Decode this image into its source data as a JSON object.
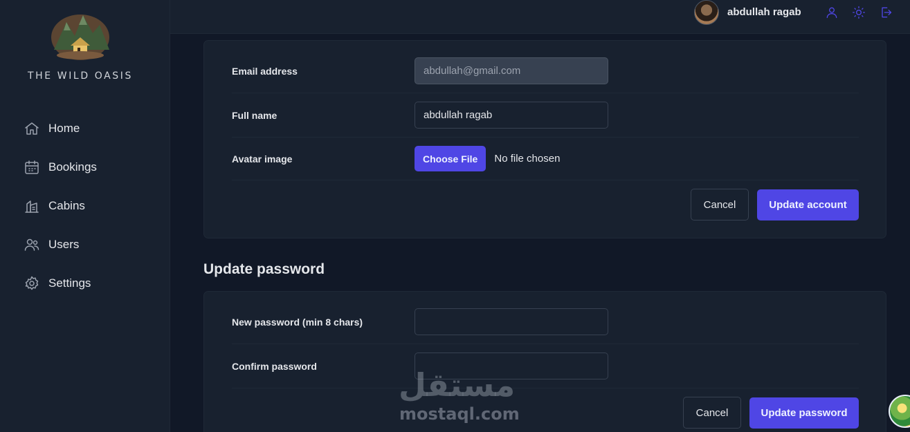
{
  "brand": {
    "name": "THE WILD OASIS",
    "logo_icon": "cabin-mountain-logo"
  },
  "nav": {
    "items": [
      {
        "label": "Home",
        "icon": "home-icon"
      },
      {
        "label": "Bookings",
        "icon": "calendar-icon"
      },
      {
        "label": "Cabins",
        "icon": "cabins-icon"
      },
      {
        "label": "Users",
        "icon": "users-icon"
      },
      {
        "label": "Settings",
        "icon": "gear-icon"
      }
    ]
  },
  "header": {
    "user_name": "abdullah ragab",
    "icons": [
      "user-icon",
      "sun-icon",
      "logout-icon"
    ],
    "accent": "#4f46e5"
  },
  "account_form": {
    "email_label": "Email address",
    "email_value": "abdullah@gmail.com",
    "fullname_label": "Full name",
    "fullname_value": "abdullah ragab",
    "avatar_label": "Avatar image",
    "choose_file": "Choose File",
    "no_file": "No file chosen",
    "cancel": "Cancel",
    "submit": "Update account"
  },
  "password_form": {
    "title": "Update password",
    "new_label": "New password (min 8 chars)",
    "new_value": "",
    "confirm_label": "Confirm password",
    "confirm_value": "",
    "cancel": "Cancel",
    "submit": "Update password"
  },
  "watermark": {
    "arabic": "مستقل",
    "latin": "mostaql.com"
  }
}
